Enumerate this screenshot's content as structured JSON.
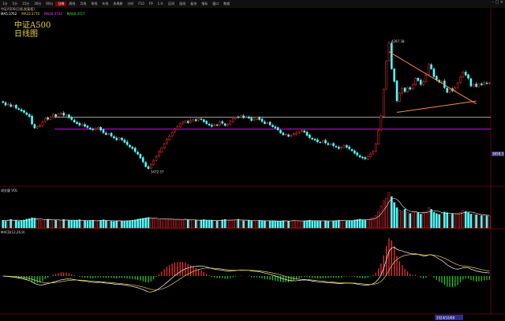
{
  "toolbar": {
    "items": [
      "1分",
      "5分",
      "15分",
      "30分",
      "60分",
      "日线",
      "周线",
      "月线",
      "季线",
      "年线",
      "多周期",
      "分时",
      "F10",
      "F9",
      "1.0·",
      "区间",
      "画线",
      "板块",
      "指标",
      "窗口",
      "数据"
    ],
    "active_index": 5
  },
  "header": {
    "info_line": "中证A500(日线,前复权)",
    "ma_labels": [
      {
        "text": "MA5:3762",
        "color": "#ffffff"
      },
      {
        "text": "MA10:3770",
        "color": "#e8d24a"
      },
      {
        "text": "MA20:3742",
        "color": "#ff44ff"
      },
      {
        "text": "MA60:3717",
        "color": "#33ff33"
      }
    ]
  },
  "title": {
    "line1": "中证A500",
    "line2": "日线图"
  },
  "colors": {
    "up": "#ff3030",
    "down": "#54ffff",
    "hline_white": "#e0e0e0",
    "hline_purple": "#b000d0",
    "triangle": "#ff8c3c"
  },
  "chart_data": {
    "type": "candlestick",
    "main": {
      "ylim": [
        3400,
        4500
      ],
      "high_label": "4297.38",
      "low_label": "3472.57",
      "last_label": "3659.3",
      "horizontal_lines": [
        {
          "value": 3820,
          "color": "white"
        },
        {
          "value": 3745,
          "color": "purple"
        }
      ],
      "triangle": {
        "upper": [
          [
            0,
            4240
          ],
          [
            30,
            3906
          ]
        ],
        "lower": [
          [
            3,
            3852
          ],
          [
            30,
            3924
          ]
        ]
      }
    },
    "volume": {
      "label": "成交量 VOL"
    },
    "macd": {
      "label": "MACD(12,26,9)"
    },
    "date_label": "2024/10/08",
    "series": {
      "close": [
        3915,
        3898,
        3904,
        3889,
        3895,
        3879,
        3870,
        3860,
        3852,
        3838,
        3825,
        3778,
        3752,
        3760,
        3768,
        3792,
        3815,
        3808,
        3820,
        3835,
        3826,
        3842,
        3845,
        3833,
        3836,
        3818,
        3806,
        3790,
        3780,
        3770,
        3775,
        3762,
        3755,
        3745,
        3740,
        3748,
        3756,
        3738,
        3722,
        3710,
        3715,
        3700,
        3688,
        3676,
        3690,
        3675,
        3660,
        3645,
        3630,
        3620,
        3600,
        3584,
        3560,
        3535,
        3505,
        3492,
        3520,
        3545,
        3570,
        3600,
        3625,
        3650,
        3680,
        3700,
        3724,
        3745,
        3760,
        3778,
        3790,
        3795,
        3786,
        3800,
        3806,
        3798,
        3812,
        3805,
        3792,
        3780,
        3770,
        3762,
        3775,
        3770,
        3790,
        3782,
        3768,
        3775,
        3795,
        3810,
        3820,
        3822,
        3830,
        3818,
        3826,
        3815,
        3800,
        3808,
        3820,
        3806,
        3794,
        3780,
        3786,
        3772,
        3760,
        3752,
        3740,
        3720,
        3708,
        3712,
        3698,
        3706,
        3714,
        3720,
        3728,
        3736,
        3725,
        3705,
        3690,
        3680,
        3674,
        3664,
        3660,
        3670,
        3656,
        3645,
        3650,
        3638,
        3630,
        3620,
        3630,
        3640,
        3628,
        3618,
        3606,
        3590,
        3578,
        3566,
        3560,
        3555,
        3568,
        3585,
        3605,
        3650,
        3735,
        3830,
        4000,
        4180,
        4297,
        4130,
        4050,
        3925,
        3975,
        4005,
        3985,
        4010,
        4000,
        4030,
        4070,
        4055,
        4030,
        4050,
        4090,
        4160,
        4130,
        4080,
        4060,
        4045,
        4050,
        4010,
        3980,
        4000,
        3990,
        4010,
        4040,
        4080,
        4110,
        4090,
        4070,
        4020,
        4030,
        4018,
        4035,
        4028,
        4042,
        4037,
        4040
      ],
      "volume": [
        45,
        42,
        48,
        50,
        44,
        46,
        40,
        43,
        47,
        52,
        55,
        60,
        58,
        50,
        46,
        44,
        48,
        52,
        50,
        47,
        45,
        43,
        46,
        50,
        48,
        45,
        44,
        43,
        46,
        49,
        45,
        42,
        40,
        44,
        46,
        43,
        41,
        45,
        48,
        44,
        42,
        40,
        39,
        43,
        46,
        41,
        40,
        42,
        44,
        46,
        48,
        52,
        55,
        57,
        60,
        62,
        58,
        55,
        52,
        50,
        56,
        54,
        52,
        50,
        48,
        51,
        53,
        50,
        49,
        52,
        47,
        45,
        48,
        46,
        44,
        47,
        49,
        45,
        43,
        46,
        44,
        42,
        45,
        48,
        50,
        46,
        44,
        47,
        49,
        51,
        45,
        43,
        44,
        46,
        42,
        41,
        43,
        45,
        44,
        42,
        40,
        41,
        43,
        42,
        39,
        41,
        43,
        44,
        40,
        42,
        45,
        43,
        41,
        39,
        42,
        44,
        46,
        43,
        41,
        40,
        42,
        44,
        43,
        41,
        40,
        42,
        44,
        46,
        45,
        43,
        41,
        42,
        44,
        47,
        50,
        52,
        48,
        46,
        50,
        56,
        62,
        72,
        95,
        130,
        160,
        175,
        210,
        185,
        150,
        120,
        105,
        98,
        110,
        92,
        85,
        100,
        96,
        90,
        82,
        88,
        95,
        120,
        110,
        92,
        85,
        80,
        86,
        94,
        90,
        78,
        82,
        80,
        86,
        92,
        105,
        98,
        90,
        82,
        84,
        78,
        80,
        74,
        76,
        72,
        70
      ]
    }
  }
}
